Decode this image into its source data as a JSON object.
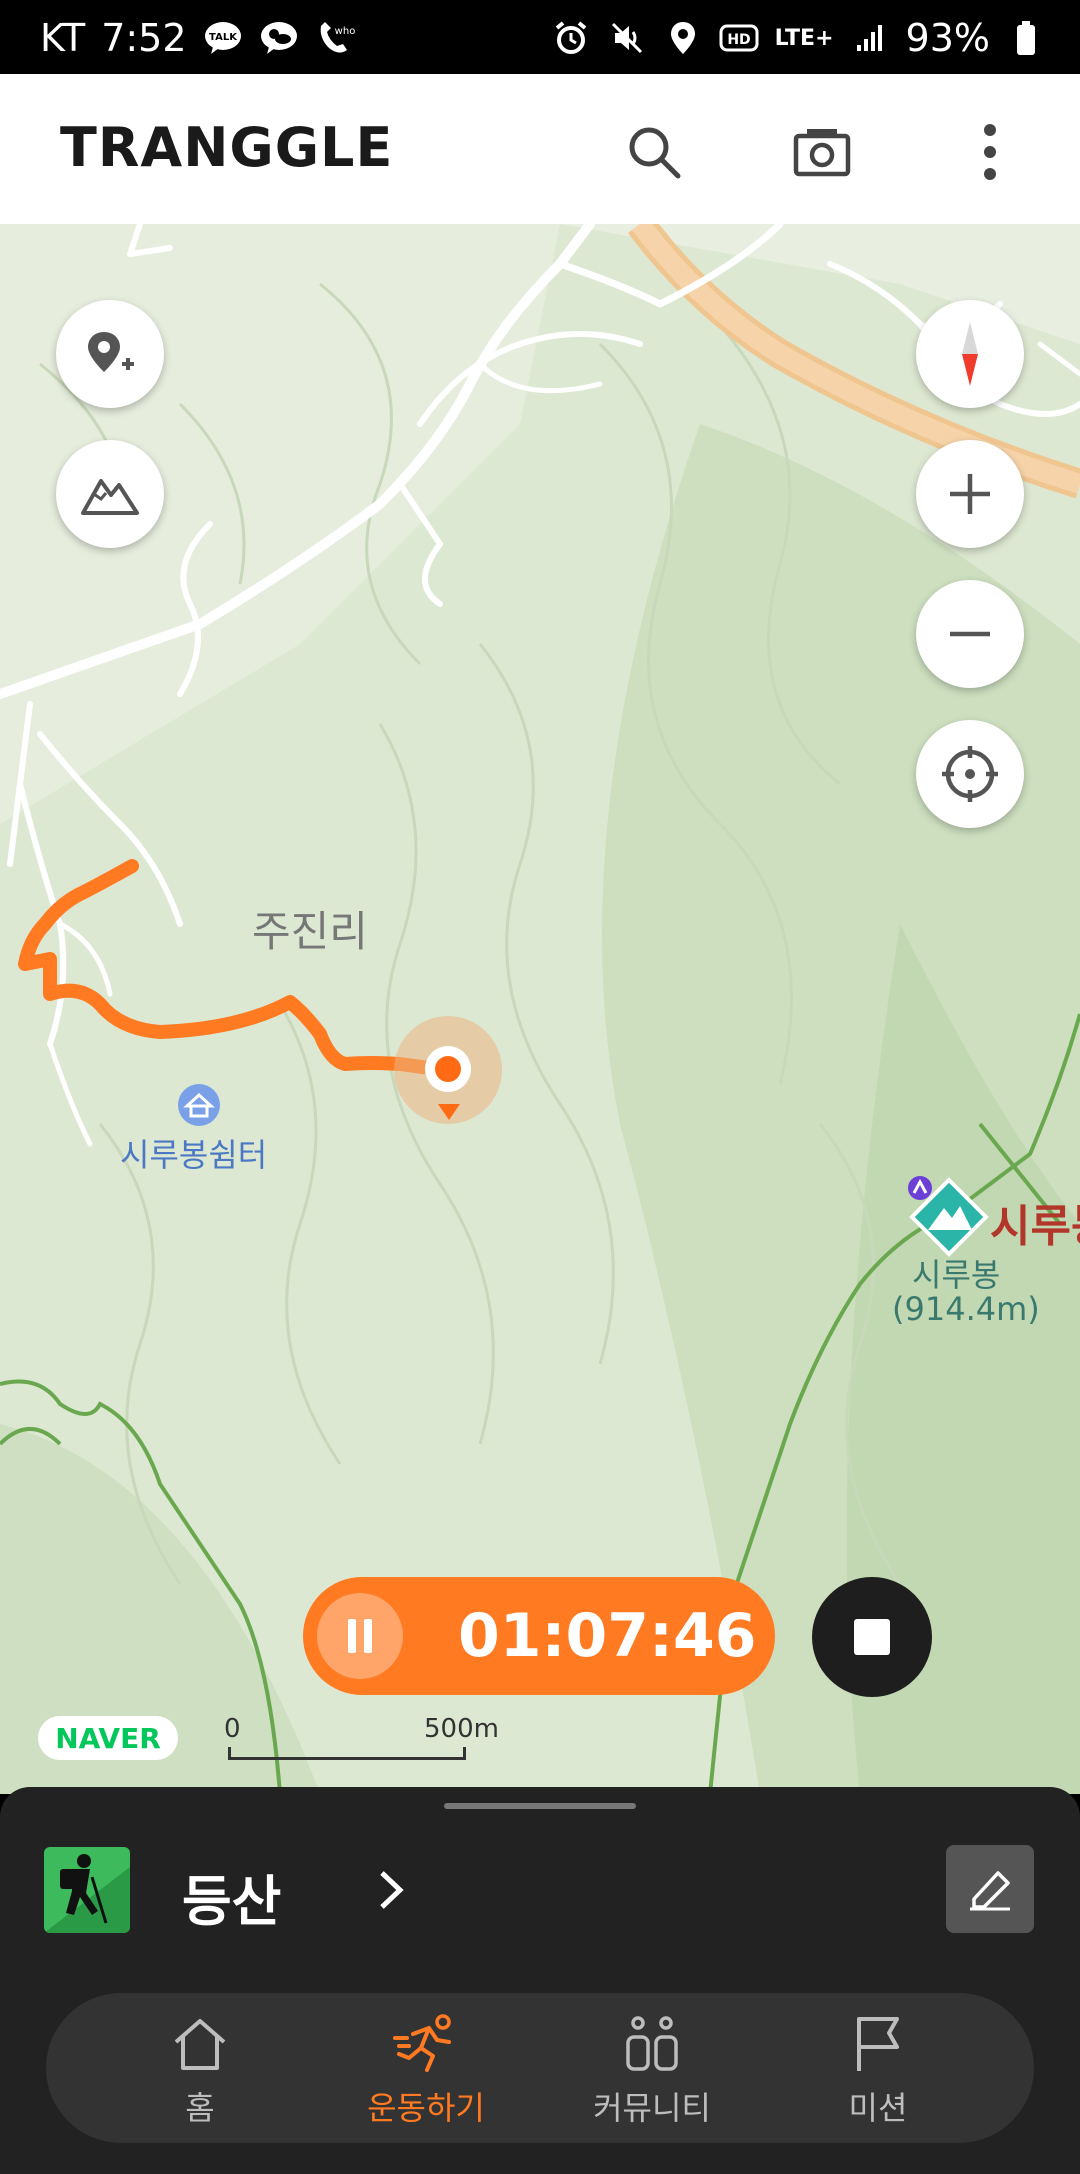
{
  "status_bar": {
    "carrier": "KT",
    "time": "7:52",
    "battery": "93%",
    "left_icons": [
      "talk-icon",
      "weather-icon",
      "whowho-icon"
    ],
    "right_icons": [
      "alarm-icon",
      "mute-icon",
      "location-icon",
      "hd-icon",
      "lte-icon",
      "signal-icon",
      "battery-icon"
    ],
    "network": "LTE+",
    "hd_label": "HD"
  },
  "app_bar": {
    "logo": "TRANGGLE",
    "actions": [
      "search-icon",
      "camera-icon",
      "more-icon"
    ]
  },
  "map": {
    "place_labels": {
      "village": "주진리",
      "shelter": "시루봉쉼터",
      "peak_name": "시루봉",
      "peak_elevation": "(914.4m)",
      "peak_title": "시루봉"
    },
    "controls_left": [
      "add-location-icon",
      "mountain-icon"
    ],
    "controls_right": [
      "compass-icon",
      "zoom-in-icon",
      "zoom-out-icon",
      "my-location-icon"
    ],
    "provider": "NAVER",
    "scale": {
      "start": "0",
      "end": "500m"
    },
    "colors": {
      "track": "#ff7a21",
      "map_bg": "#dde8d2",
      "road_major": "#f5c48a",
      "trail": "#6aa84f"
    }
  },
  "recording": {
    "elapsed": "01:07:46",
    "accent": "#ff7a21"
  },
  "activity": {
    "label": "등산",
    "icon": "hiking-icon"
  },
  "nav": {
    "items": [
      {
        "label": "홈",
        "icon": "home-icon",
        "active": false
      },
      {
        "label": "운동하기",
        "icon": "running-icon",
        "active": true
      },
      {
        "label": "커뮤니티",
        "icon": "community-icon",
        "active": false
      },
      {
        "label": "미션",
        "icon": "flag-icon",
        "active": false
      }
    ],
    "active_color": "#ff7a21",
    "inactive_color": "#bdbdbd"
  }
}
